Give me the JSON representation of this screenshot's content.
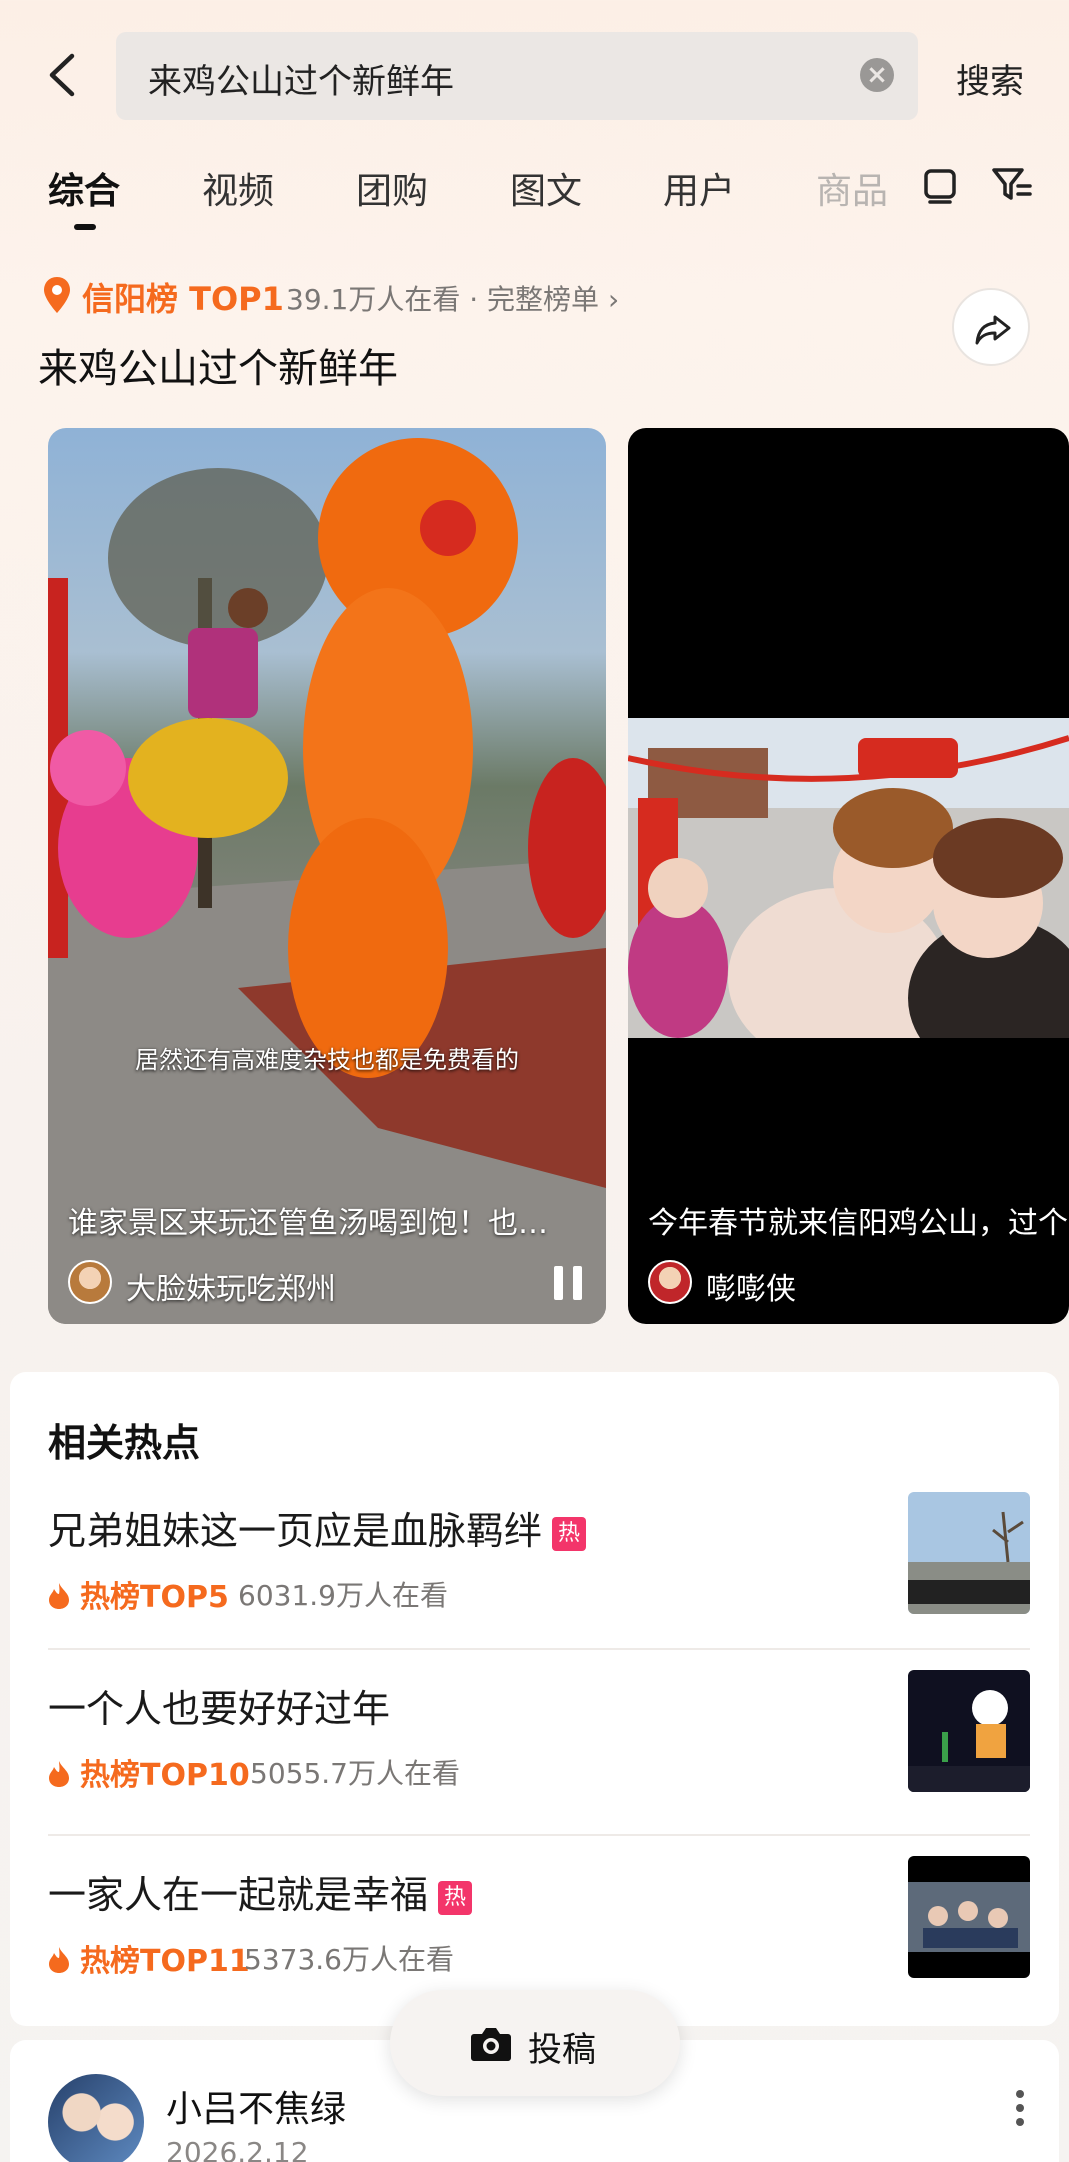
{
  "search": {
    "query": "来鸡公山过个新鲜年",
    "submit_label": "搜索"
  },
  "tabs": [
    {
      "label": "综合"
    },
    {
      "label": "视频"
    },
    {
      "label": "团购"
    },
    {
      "label": "图文"
    },
    {
      "label": "用户"
    },
    {
      "label": "商品"
    }
  ],
  "hot_list": {
    "rank_label": "信阳榜 TOP1",
    "meta": "39.1万人在看 · 完整榜单 ›",
    "title": "来鸡公山过个新鲜年"
  },
  "videos": [
    {
      "caption": "居然还有高难度杂技也都是免费看的",
      "description": "谁家景区来玩还管鱼汤喝到饱！也…",
      "author": "大脸妹玩吃郑州"
    },
    {
      "description": "今年春节就来信阳鸡公山，过个",
      "author": "嘭嘭侠"
    }
  ],
  "related": {
    "title": "相关热点",
    "items": [
      {
        "text": "兄弟姐妹这一页应是血脉羁绊",
        "badge": "热",
        "rank": "热榜TOP5",
        "views": "6031.9万人在看"
      },
      {
        "text": "一个人也要好好过年",
        "badge": "",
        "rank": "热榜TOP10",
        "views": "5055.7万人在看"
      },
      {
        "text": "一家人在一起就是幸福",
        "badge": "热",
        "rank": "热榜TOP11",
        "views": "5373.6万人在看"
      }
    ]
  },
  "post": {
    "author": "小吕不焦绿",
    "date": "2026.2.12"
  },
  "submit": {
    "label": "投稿"
  },
  "colors": {
    "accent_orange": "#f56a1e",
    "hot_badge": "#f3356a"
  }
}
